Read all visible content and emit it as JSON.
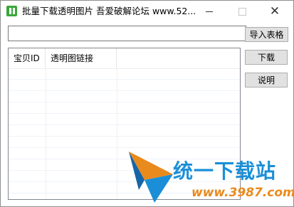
{
  "window": {
    "title": "批量下载透明图片  吾爱破解论坛  www.52...",
    "icon": "app-icon",
    "controls": [
      "minimize",
      "maximize",
      "close"
    ]
  },
  "form": {
    "path_value": "",
    "import_label": "导入表格",
    "download_label": "下载",
    "explain_label": "说明"
  },
  "table": {
    "columns": [
      "宝贝ID",
      "透明图链接"
    ],
    "rows": []
  },
  "watermark": {
    "brand": "统一下载站",
    "url": "www.3987.com"
  },
  "colors": {
    "watermark_blue": "#1a8fd8",
    "watermark_orange": "#e98a1d",
    "app_icon_green": "#3aa63a"
  }
}
